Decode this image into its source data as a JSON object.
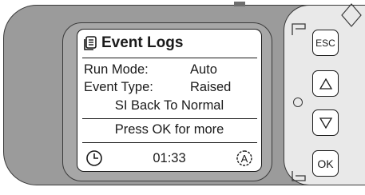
{
  "screen": {
    "title": "Event Logs",
    "rows": [
      {
        "label": "Run Mode:",
        "value": "Auto"
      },
      {
        "label": "Event Type:",
        "value": "Raised"
      }
    ],
    "message": "SI Back To Normal",
    "prompt": "Press OK for more",
    "time": "01:33",
    "mode_badge": "A"
  },
  "buttons": {
    "esc": "ESC",
    "ok": "OK"
  },
  "icons": {
    "title_icon": "document-list-icon",
    "clock_icon": "clock-icon",
    "up_icon": "triangle-up-icon",
    "down_icon": "triangle-down-icon",
    "auto_icon": "auto-mode-icon"
  },
  "colors": {
    "housing": "#9b9b9b",
    "bezel": "#a7a7a7",
    "side_panel": "#e9e9e9",
    "screen": "#ffffff",
    "ink": "#1a1a1a"
  }
}
